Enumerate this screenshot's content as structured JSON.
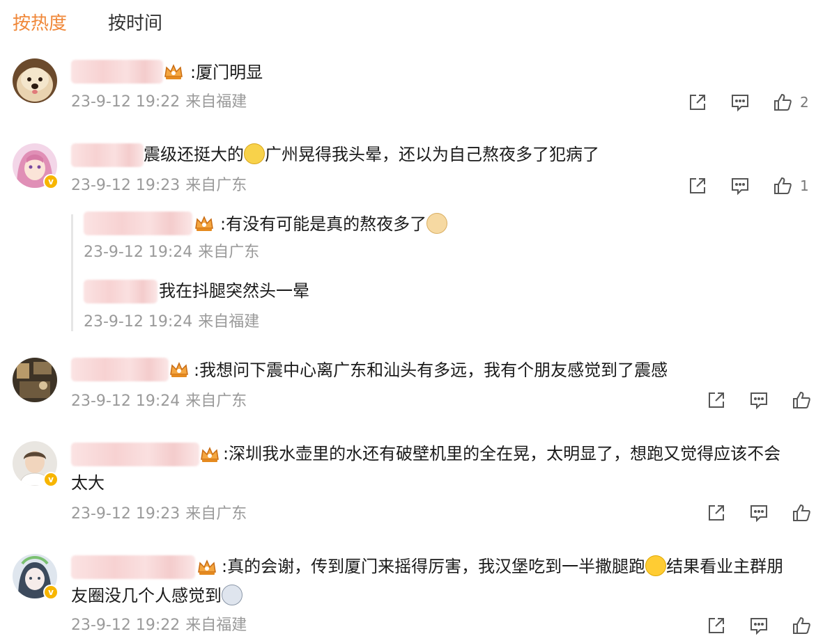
{
  "tabs": {
    "hot": "按热度",
    "time": "按时间"
  },
  "colors": {
    "accent": "#f0883a",
    "meta": "#9a9a9a",
    "badge": "#f7b500"
  },
  "comments": [
    {
      "text": ":厦门明显",
      "date": "23-9-12 19:22",
      "source": "来自福建",
      "likes": "2",
      "avatar": "dog-avatar"
    },
    {
      "text_a": "震级还挺大的",
      "text_b": "广州晃得我头晕，还以为自己熬夜多了犯病了",
      "emoji": "cat-emoji",
      "date": "23-9-12 19:23",
      "source": "来自广东",
      "likes": "1",
      "avatar": "anime-avatar",
      "verified": true,
      "replies": [
        {
          "text": ":有没有可能是真的熬夜多了",
          "emoji": "dog-emoji",
          "date": "23-9-12 19:24",
          "source": "来自广东"
        },
        {
          "text": "我在抖腿突然头一晕",
          "date": "23-9-12 19:24",
          "source": "来自福建"
        }
      ]
    },
    {
      "text": ":我想问下震中心离广东和汕头有多远，我有个朋友感觉到了震感",
      "date": "23-9-12 19:24",
      "source": "来自广东",
      "avatar": "photo-avatar"
    },
    {
      "line1": ":深圳我水壶里的水还有破壁机里的全在晃，太明显了，想跑又觉得应该不会",
      "line2": "太大",
      "date": "23-9-12 19:23",
      "source": "来自广东",
      "avatar": "boy-avatar",
      "verified": true
    },
    {
      "line1a": ":真的会谢，传到厦门来摇得厉害，我汉堡吃到一半撒腿跑",
      "line1b": "结果看业主群朋",
      "line2": "友圈没几个人感觉到",
      "date": "23-9-12 19:22",
      "source": "来自福建",
      "avatar": "girl-avatar",
      "verified": true
    }
  ],
  "icons": {
    "share": "share-icon",
    "comment": "comment-icon",
    "like": "like-icon",
    "crown": "crown-badge-icon",
    "verified": "verified-badge-icon"
  }
}
